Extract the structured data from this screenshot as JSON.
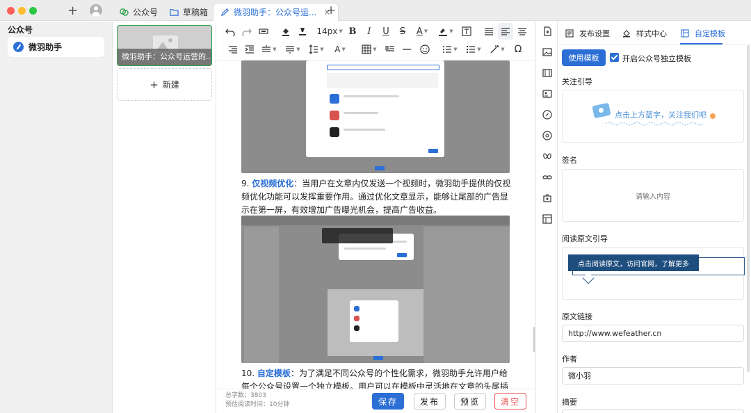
{
  "tabs": [
    {
      "label": "公众号",
      "icon": "wechat-icon"
    },
    {
      "label": "草稿箱",
      "icon": "folder-icon"
    },
    {
      "label": "微羽助手：公众号运...",
      "icon": "edit-icon"
    }
  ],
  "sidebar": {
    "title": "公众号",
    "items": [
      {
        "label": "微羽助手",
        "icon": "feather-logo-icon"
      }
    ]
  },
  "doclist": {
    "items": [
      {
        "title": "微羽助手：公众号运营的..."
      }
    ],
    "new_label": "新建"
  },
  "toolbar": {
    "font_size": "14px"
  },
  "editor": {
    "paragraphs": [
      {
        "number": "9.",
        "heading": "仅视频优化",
        "body": "：当用户在文章内仅发送一个视频时，微羽助手提供的仅视频优化功能可以发挥重要作用。通过优化文章显示，能够让尾部的广告显示在第一屏，有效增加广告曝光机会，提高广告收益。"
      },
      {
        "number": "10.",
        "heading": "自定模板",
        "body": "：为了满足不同公众号的个性化需求，微羽助手允许用户给每个公众号设置一个独立模板。用户可以在模板中灵活地在文章的头尾插入引导语、签名、阅"
      }
    ]
  },
  "footer": {
    "word_count": "总字数：3803",
    "read_time": "预估阅读时间：10分钟",
    "save": "保存",
    "publish": "发布",
    "preview": "预览",
    "clear": "清空"
  },
  "panel": {
    "tabs": [
      {
        "label": "发布设置",
        "icon": "settings-icon"
      },
      {
        "label": "样式中心",
        "icon": "paint-icon"
      },
      {
        "label": "自定模板",
        "icon": "template-icon"
      }
    ],
    "active_tab": "自定模板",
    "use_template": "使用模板",
    "independent_template": "开启公众号独立模板",
    "follow_label": "关注引导",
    "follow_text": "点击上方蓝字，关注我们吧",
    "signature_label": "签名",
    "signature_placeholder": "请输入内容",
    "read_label": "阅读原文引导",
    "read_text": "点击阅读原文，访问官网，了解更多",
    "link_label": "原文链接",
    "link_value": "http://www.wefeather.cn",
    "author_label": "作者",
    "author_value": "微小羽",
    "summary_label": "摘要"
  },
  "colors": {
    "accent": "#2b6fd6",
    "success_border": "#2fa34c",
    "danger": "#e55555",
    "banner": "#1e4e7e"
  }
}
